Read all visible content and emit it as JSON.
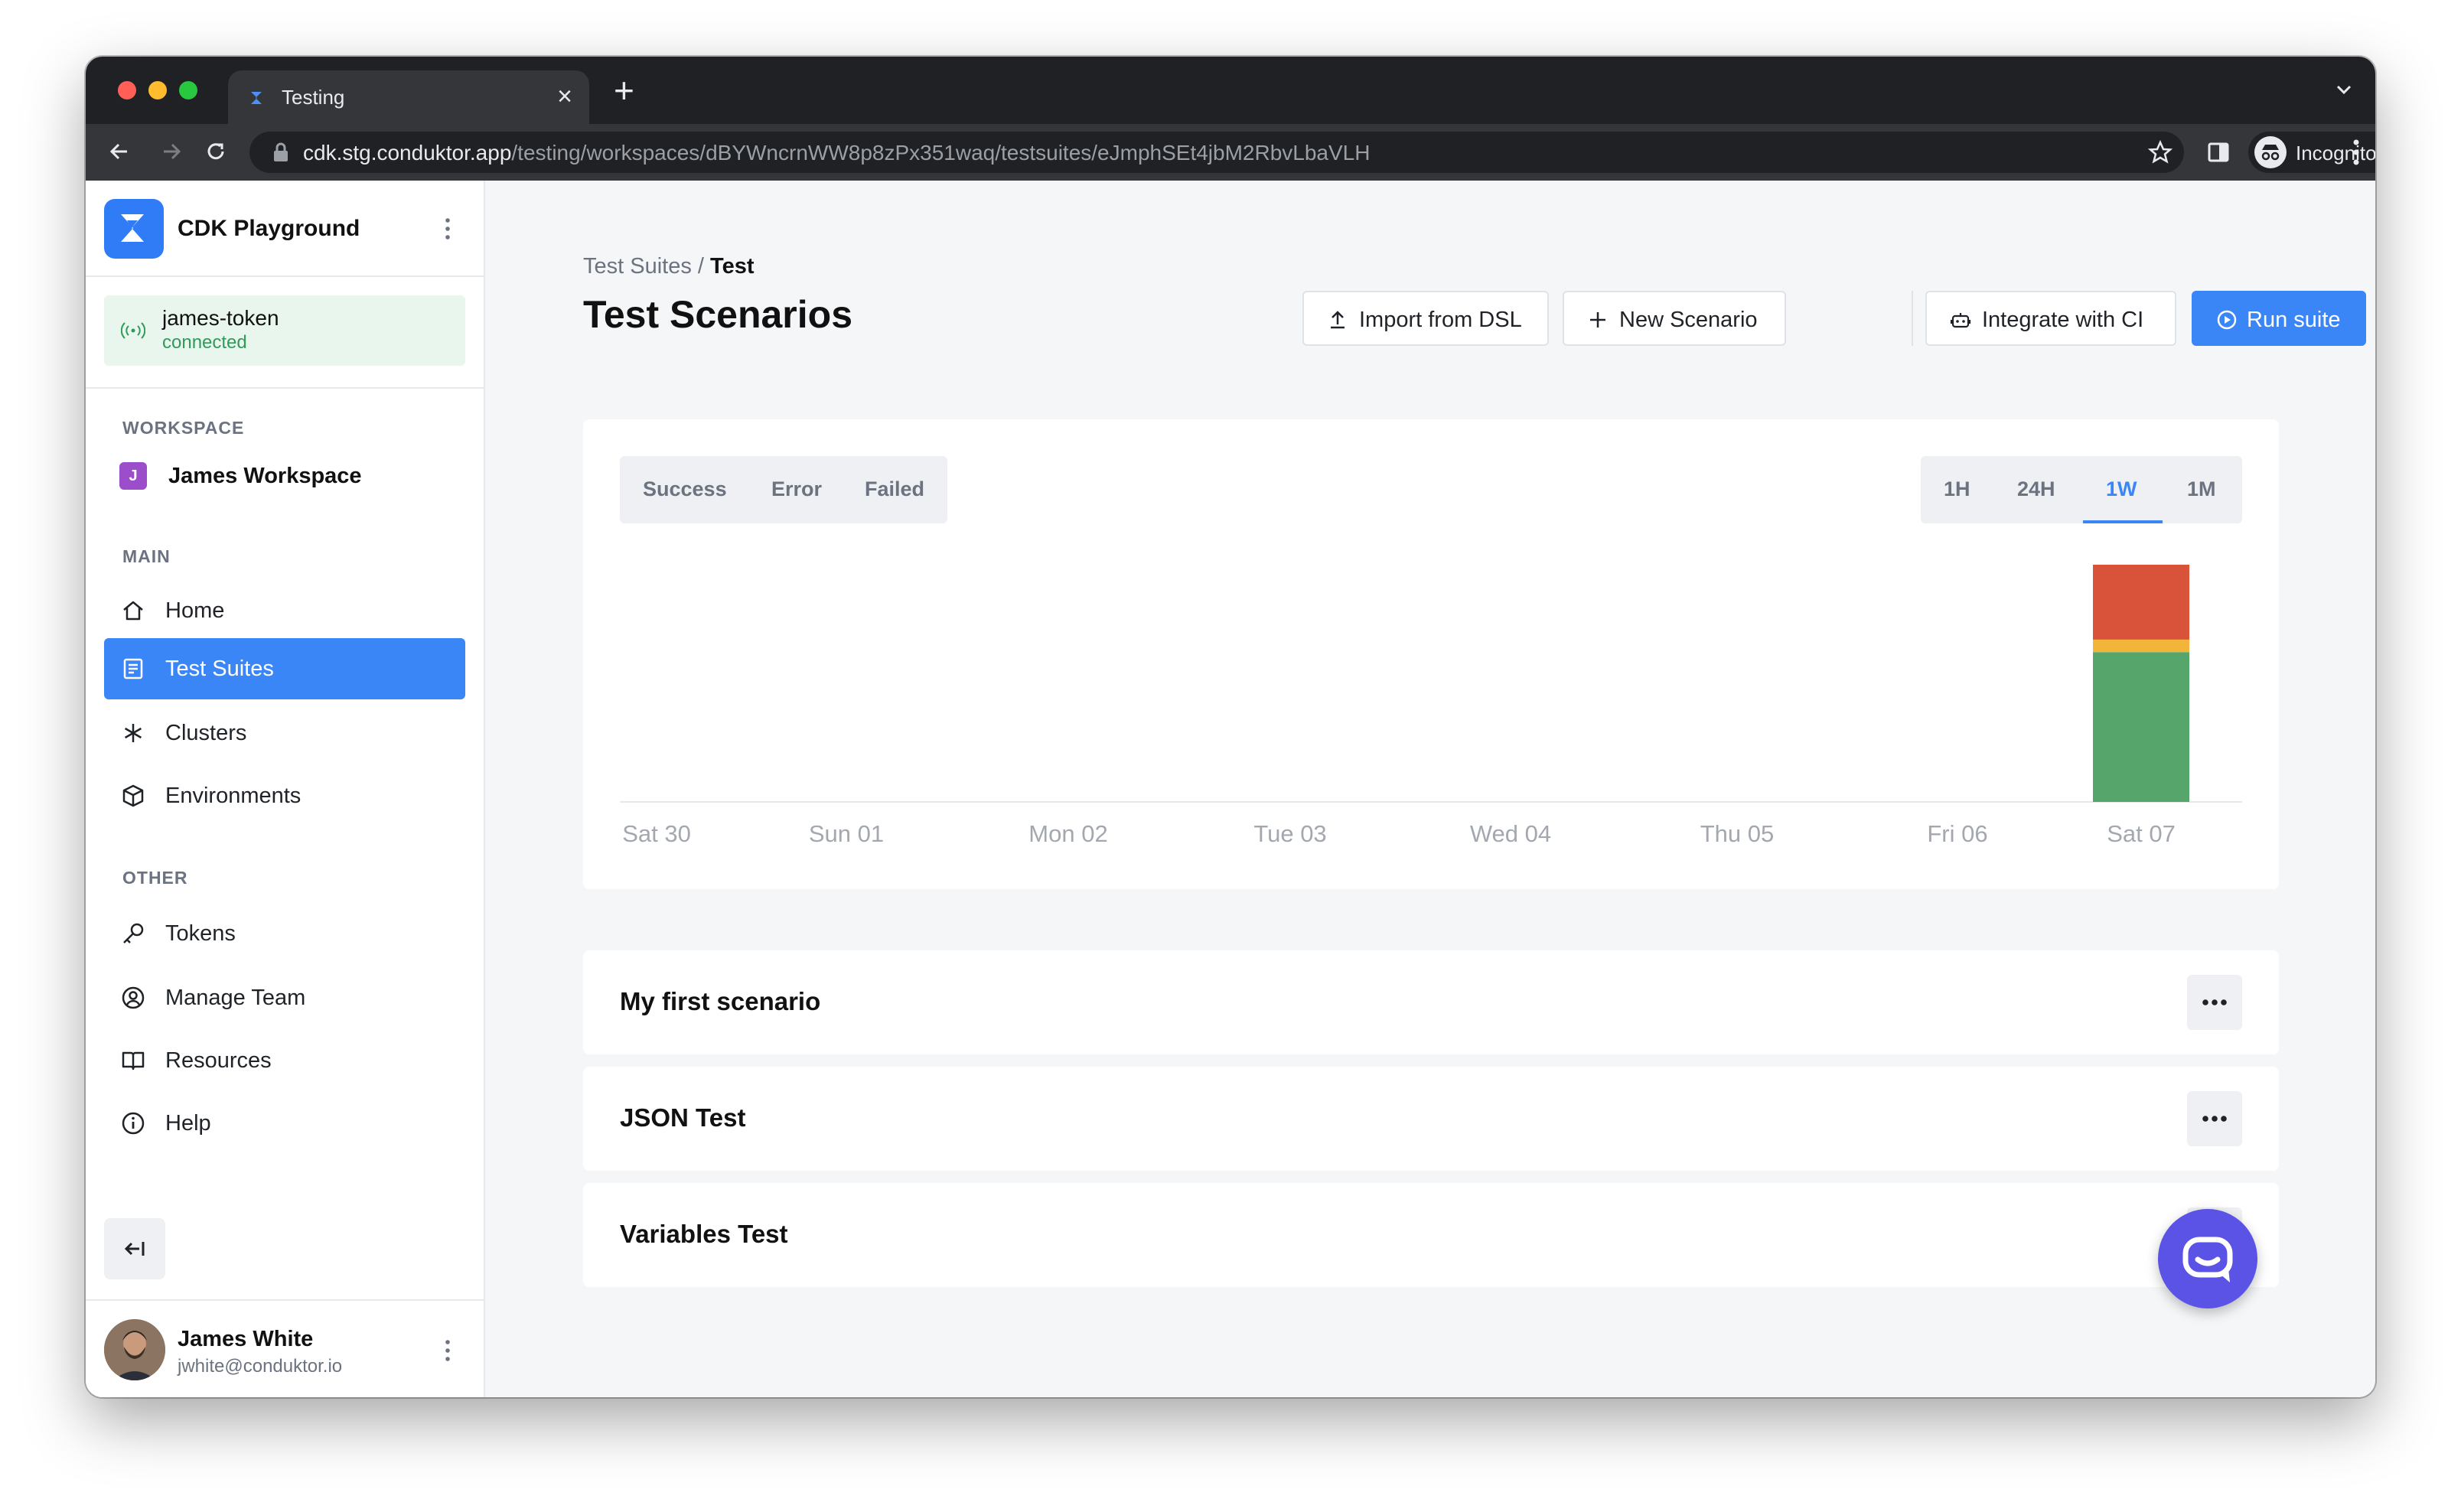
{
  "browser": {
    "tab_title": "Testing",
    "url_host": "cdk.stg.conduktor.app",
    "url_path": "/testing/workspaces/dBYWncrnWW8p8zPx351waq/testsuites/eJmphSEt4jbM2RbvLbaVLH",
    "profile_label": "Incognito"
  },
  "sidebar": {
    "app_name": "CDK Playground",
    "token": {
      "name": "james-token",
      "status": "connected"
    },
    "workspace_label": "WORKSPACE",
    "workspace": {
      "initial": "J",
      "name": "James Workspace"
    },
    "main_label": "MAIN",
    "main_items": [
      {
        "label": "Home",
        "icon": "home-icon"
      },
      {
        "label": "Test Suites",
        "icon": "document-icon"
      },
      {
        "label": "Clusters",
        "icon": "asterisk-icon"
      },
      {
        "label": "Environments",
        "icon": "cube-icon"
      }
    ],
    "other_label": "OTHER",
    "other_items": [
      {
        "label": "Tokens",
        "icon": "key-icon"
      },
      {
        "label": "Manage Team",
        "icon": "user-circle-icon"
      },
      {
        "label": "Resources",
        "icon": "book-icon"
      },
      {
        "label": "Help",
        "icon": "info-icon"
      }
    ],
    "user": {
      "name": "James White",
      "email": "jwhite@conduktor.io"
    }
  },
  "main": {
    "breadcrumb_parent": "Test Suites",
    "breadcrumb_separator": "/",
    "breadcrumb_current": "Test",
    "title": "Test Scenarios",
    "buttons": {
      "import": "Import from DSL",
      "new_scenario": "New Scenario",
      "integrate": "Integrate with CI",
      "run": "Run suite"
    },
    "status_filters": [
      "Success",
      "Error",
      "Failed"
    ],
    "time_ranges": [
      "1H",
      "24H",
      "1W",
      "1M"
    ],
    "active_time_range": "1W",
    "scenarios": [
      "My first scenario",
      "JSON Test",
      "Variables Test"
    ]
  },
  "colors": {
    "accent": "#3b86f7",
    "success": "#56a56b",
    "error": "#f2b53a",
    "failed": "#d9533b"
  },
  "chart_data": {
    "type": "bar",
    "stacked": true,
    "categories": [
      "Sat 30",
      "Sun 01",
      "Mon 02",
      "Tue 03",
      "Wed 04",
      "Thu 05",
      "Fri 06",
      "Sat 07"
    ],
    "series": [
      {
        "name": "Success",
        "values": [
          0,
          0,
          0,
          0,
          0,
          0,
          0,
          6
        ],
        "color": "#56a56b"
      },
      {
        "name": "Error",
        "values": [
          0,
          0,
          0,
          0,
          0,
          0,
          0,
          0.5
        ],
        "color": "#f2b53a"
      },
      {
        "name": "Failed",
        "values": [
          0,
          0,
          0,
          0,
          0,
          0,
          0,
          3
        ],
        "color": "#d9533b"
      }
    ],
    "ylim": [
      0,
      9.5
    ],
    "grid": false
  }
}
